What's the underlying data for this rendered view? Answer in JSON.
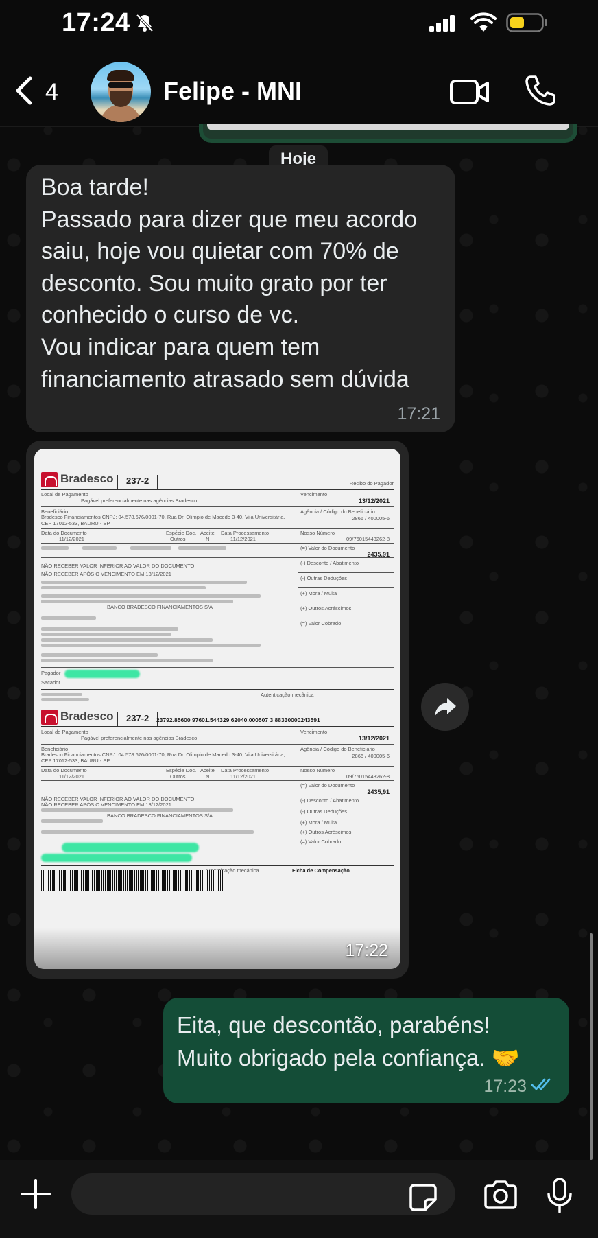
{
  "status_bar": {
    "time": "17:24"
  },
  "header": {
    "back_count": "4",
    "contact_name": "Felipe - MNI"
  },
  "chat": {
    "date_chip": "Hoje",
    "incoming_message": {
      "text": "Boa tarde!\nPassado para dizer que meu acordo saiu, hoje vou quietar com 70% de desconto. Sou muito grato por ter conhecido o curso de vc.\nVou indicar para quem tem financiamento atrasado sem dúvida",
      "time": "17:21"
    },
    "image_message": {
      "time": "17:22",
      "boleto": {
        "brand": "Bradesco",
        "bank_code": "237-2",
        "recibo": "Recibo do Pagador",
        "local_label": "Local de Pagamento",
        "local_value": "Pagável preferencialmente nas agências Bradesco",
        "vencimento_label": "Vencimento",
        "vencimento": "13/12/2021",
        "beneficiario_label": "Beneficiário",
        "beneficiario": "Bradesco Financiamentos CNPJ: 04.578.676/0001-70, Rua Dr. Olimpio de Macedo 3-40, Vila Universitária, CEP 17012-533, BAURU - SP",
        "agencia_label": "Agência / Código do Beneficiário",
        "agencia": "2866 / 400005-6",
        "data_doc_label": "Data do Documento",
        "data_doc": "11/12/2021",
        "especie_label": "Espécie Doc.",
        "especie": "Outros",
        "aceite_label": "Aceite",
        "aceite": "N",
        "processamento_label": "Data Processamento",
        "processamento": "11/12/2021",
        "nosso_numero_label": "Nosso Número",
        "nosso_numero": "09/76015443262-8",
        "valor_label": "(=) Valor do Documento",
        "valor": "2435,91",
        "notice1": "NÃO RECEBER VALOR INFERIOR AO VALOR DO DOCUMENTO",
        "notice2": "NÃO RECEBER APÓS O VENCIMENTO EM 13/12/2021",
        "descontos": "(-) Desconto / Abatimento",
        "outras_deducoes": "(-) Outras Deduções",
        "mora": "(+) Mora / Multa",
        "acrescimos": "(+) Outros Acréscimos",
        "valor_cobrado": "(=) Valor Cobrado",
        "banco": "BANCO BRADESCO FINANCIAMENTOS S/A",
        "pagador_label": "Pagador",
        "sacador_label": "Sacador",
        "autenticacao": "Autenticação mecânica",
        "linha_digitavel": "23792.85600 97601.544329 62040.000507 3 88330000243591",
        "ficha": "Ficha de Compensação"
      }
    },
    "outgoing_message": {
      "text": "Eita, que descontão, parabéns!\nMuito obrigado pela confiança. 🤝",
      "time": "17:23"
    }
  },
  "colors": {
    "incoming_bubble": "#252525",
    "outgoing_bubble": "#144d37",
    "read_ticks": "#53bdeb",
    "battery_fill": "#f7d21c"
  },
  "icons": [
    "bell-slash-icon",
    "signal-icon",
    "wifi-icon",
    "battery-icon",
    "back-chevron-icon",
    "video-call-icon",
    "phone-icon",
    "forward-icon",
    "read-ticks-icon",
    "plus-icon",
    "sticker-icon",
    "camera-icon",
    "mic-icon"
  ]
}
